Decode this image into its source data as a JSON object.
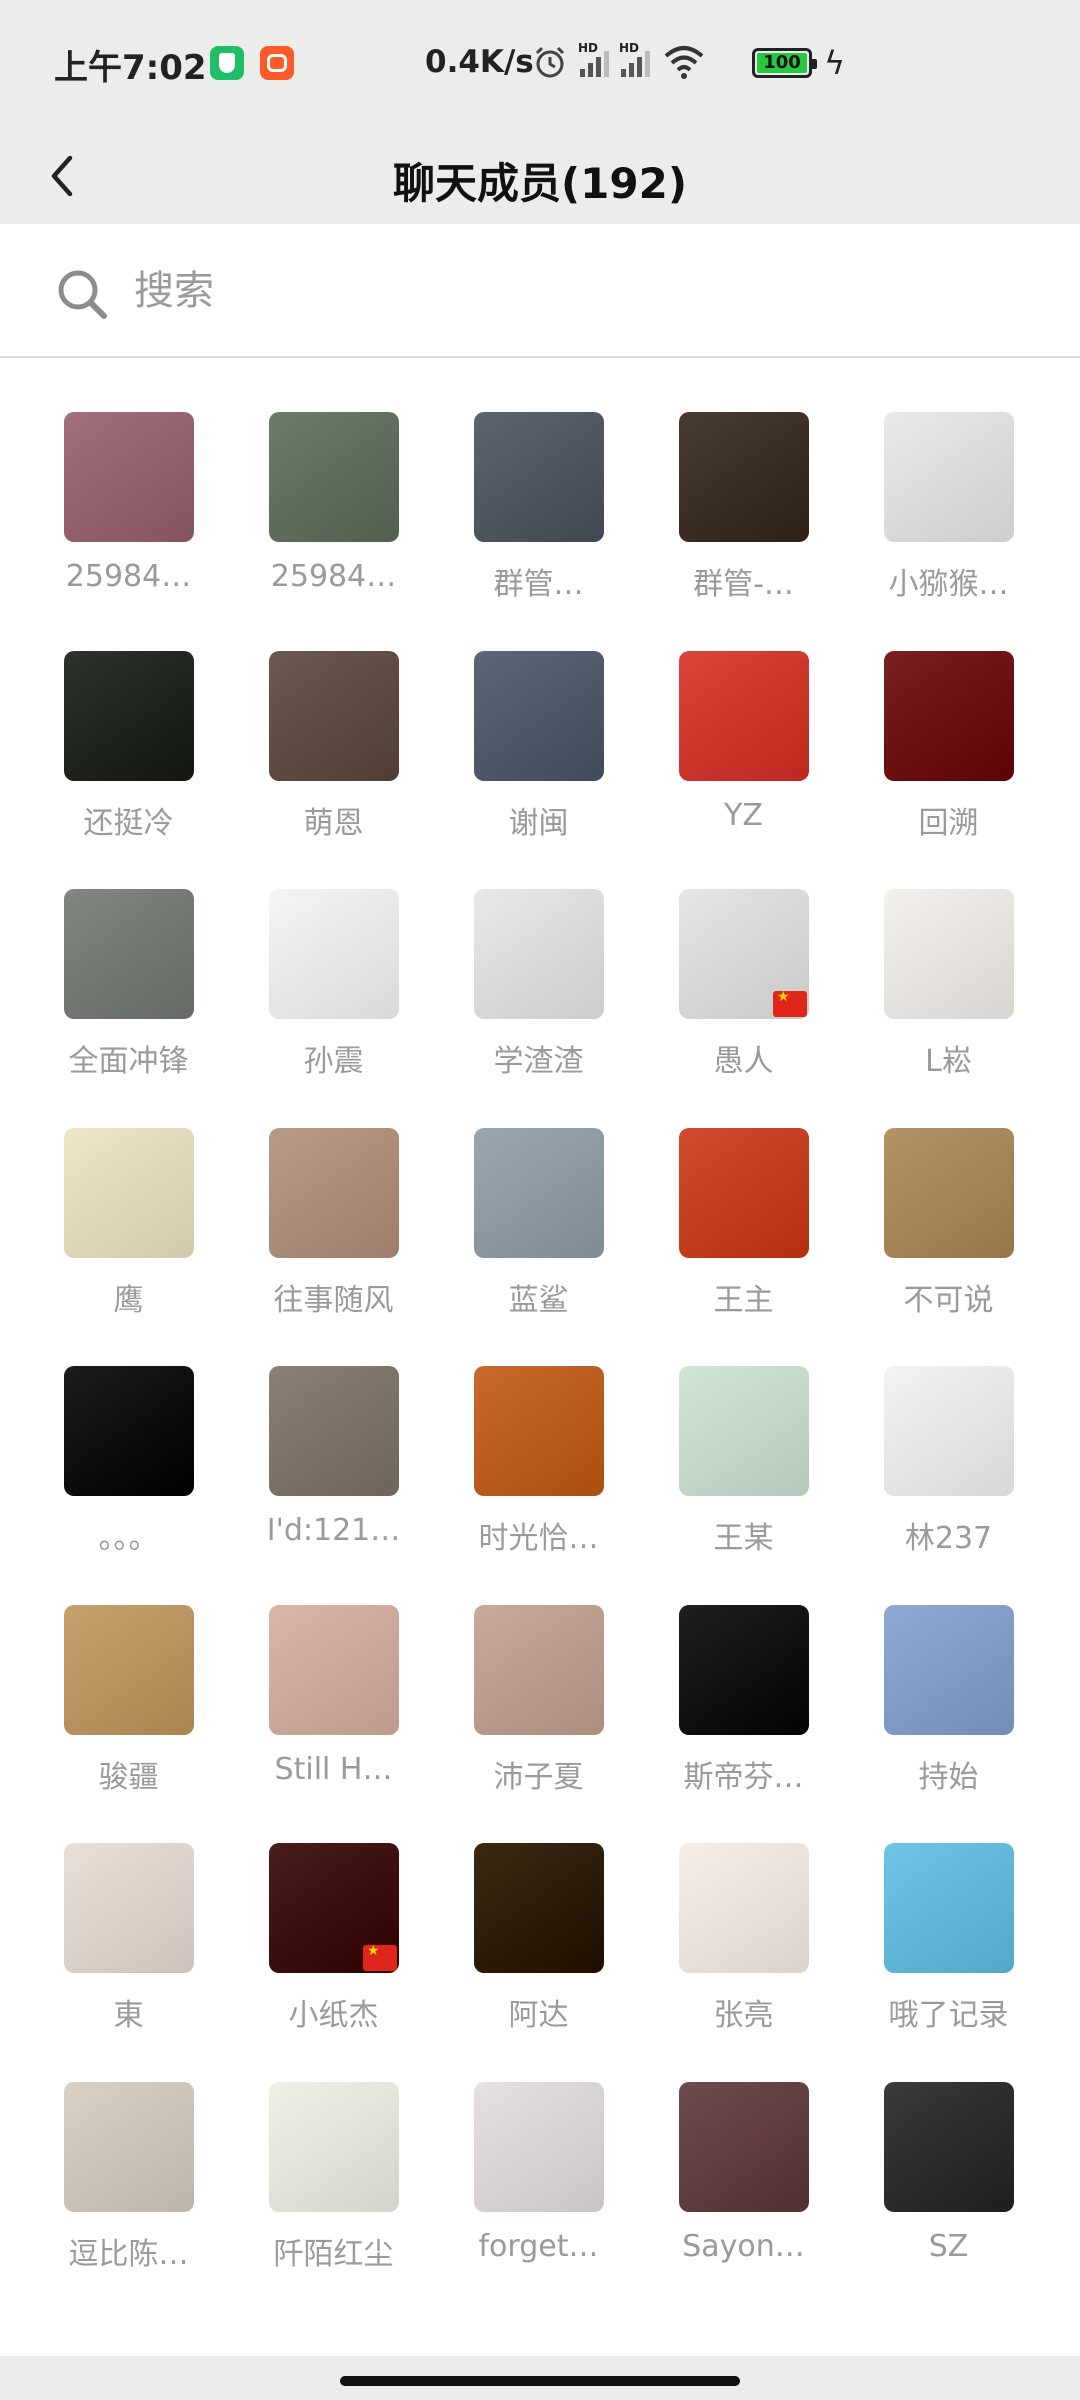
{
  "status_bar": {
    "time": "上午7:02",
    "net_speed": "0.4K/s",
    "battery": "100",
    "icons": [
      "app-shield-icon",
      "app-video-icon",
      "alarm-icon",
      "signal-hd-icon",
      "signal-hd-icon",
      "wifi-icon",
      "battery-icon",
      "charging-icon"
    ]
  },
  "header": {
    "back_icon": "chevron-left-icon",
    "title": "聊天成员(192)"
  },
  "search": {
    "icon": "search-icon",
    "placeholder": "搜索",
    "value": ""
  },
  "members": [
    {
      "name": "25984…",
      "color": "#a2707a"
    },
    {
      "name": "25984…",
      "color": "#6d7b6a"
    },
    {
      "name": "群管…",
      "color": "#5d646e"
    },
    {
      "name": "群管-…",
      "color": "#4a3b33"
    },
    {
      "name": "小猕猴…",
      "color": "#e9e9e9"
    },
    {
      "name": "还挺冷",
      "color": "#2d332c"
    },
    {
      "name": "萌恩",
      "color": "#6b5a4f"
    },
    {
      "name": "谢闽",
      "color": "#5d6677"
    },
    {
      "name": "YZ",
      "color": "#d9453a"
    },
    {
      "name": "回溯",
      "color": "#7a1f1f"
    },
    {
      "name": "全面冲锋",
      "color": "#7f8780"
    },
    {
      "name": "孙震",
      "color": "#f5f5f5"
    },
    {
      "name": "学渣渣",
      "color": "#e8e8e8"
    },
    {
      "name": "愚人",
      "color": "#e4e6e4",
      "flag": true
    },
    {
      "name": "L崧",
      "color": "#f4f0ec"
    },
    {
      "name": "鹰",
      "color": "#efe4c8"
    },
    {
      "name": "往事随风",
      "color": "#b89a86"
    },
    {
      "name": "蓝鲨",
      "color": "#9aa6b0"
    },
    {
      "name": "王主",
      "color": "#d34a2c"
    },
    {
      "name": "不可说",
      "color": "#b39365"
    },
    {
      "name": "。。。",
      "color": "#1c1c1e"
    },
    {
      "name": "I'd:121…",
      "color": "#8a8074"
    },
    {
      "name": "时光恰…",
      "color": "#c86a2c"
    },
    {
      "name": "王某",
      "color": "#cfe6d6"
    },
    {
      "name": "林237",
      "color": "#f3f3f3"
    },
    {
      "name": "骏疆",
      "color": "#c7a06e"
    },
    {
      "name": "Still H…",
      "color": "#d9b6a8"
    },
    {
      "name": "沛子夏",
      "color": "#c8a99a"
    },
    {
      "name": "斯帝芬…",
      "color": "#1f1f1f"
    },
    {
      "name": "持始",
      "color": "#8fa9d4"
    },
    {
      "name": "東",
      "color": "#eadfd6"
    },
    {
      "name": "小纸杰",
      "color": "#4a1d1d",
      "flag": true
    },
    {
      "name": "阿达",
      "color": "#3b2a12"
    },
    {
      "name": "张亮",
      "color": "#f6efe9"
    },
    {
      "name": "哦了记录",
      "color": "#6fc4e6"
    },
    {
      "name": "逗比陈…",
      "color": "#d9d0c6"
    },
    {
      "name": "阡陌红尘",
      "color": "#eff1e6"
    },
    {
      "name": "forget…",
      "color": "#e6e0e4"
    },
    {
      "name": "Sayon…",
      "color": "#6e4b4f"
    },
    {
      "name": "SZ",
      "color": "#3a3a3a"
    }
  ]
}
